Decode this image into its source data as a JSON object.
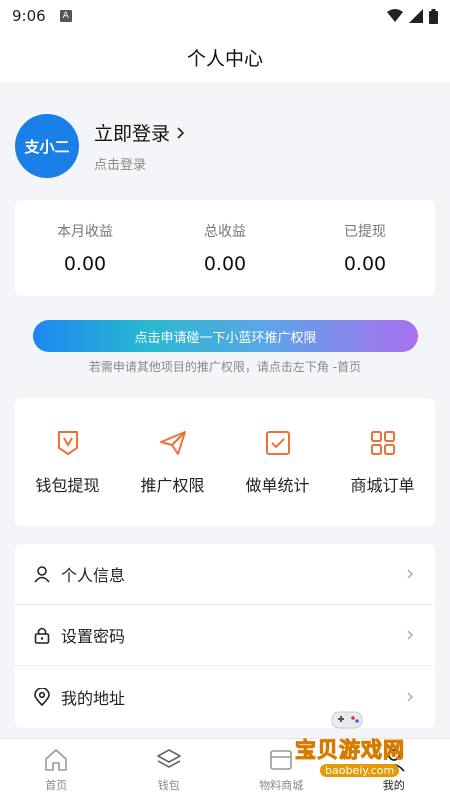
{
  "status_bar": {
    "time": "9:06",
    "notif_letter": "A"
  },
  "header": {
    "title": "个人中心"
  },
  "profile": {
    "avatar_text": "支小二",
    "login_title": "立即登录",
    "login_sub": "点击登录"
  },
  "earnings": [
    {
      "label": "本月收益",
      "value": "0.00"
    },
    {
      "label": "总收益",
      "value": "0.00"
    },
    {
      "label": "已提现",
      "value": "0.00"
    }
  ],
  "promo": {
    "button": "点击申请碰一下小蓝环推广权限",
    "note": "若需申请其他项目的推广权限，请点击左下角 -首页"
  },
  "grid": [
    {
      "label": "钱包提现",
      "icon": "wallet-withdraw-icon"
    },
    {
      "label": "推广权限",
      "icon": "paper-plane-icon"
    },
    {
      "label": "做单统计",
      "icon": "check-square-icon"
    },
    {
      "label": "商城订单",
      "icon": "grid-icon"
    }
  ],
  "menu": [
    {
      "label": "个人信息",
      "icon": "user-icon"
    },
    {
      "label": "设置密码",
      "icon": "lock-icon"
    },
    {
      "label": "我的地址",
      "icon": "location-pin-icon"
    }
  ],
  "tabs": [
    {
      "label": "首页",
      "icon": "home-icon"
    },
    {
      "label": "钱包",
      "icon": "layers-icon"
    },
    {
      "label": "物料商城",
      "icon": "store-icon"
    },
    {
      "label": "我的",
      "icon": "person-icon"
    }
  ],
  "watermark": {
    "text": "宝贝游戏网",
    "url": "baobeiy.com"
  },
  "colors": {
    "accent": "#1a7fe6",
    "icon_orange": "#f0703a",
    "gradient_start": "#1d86f2",
    "gradient_end": "#a970f0"
  }
}
